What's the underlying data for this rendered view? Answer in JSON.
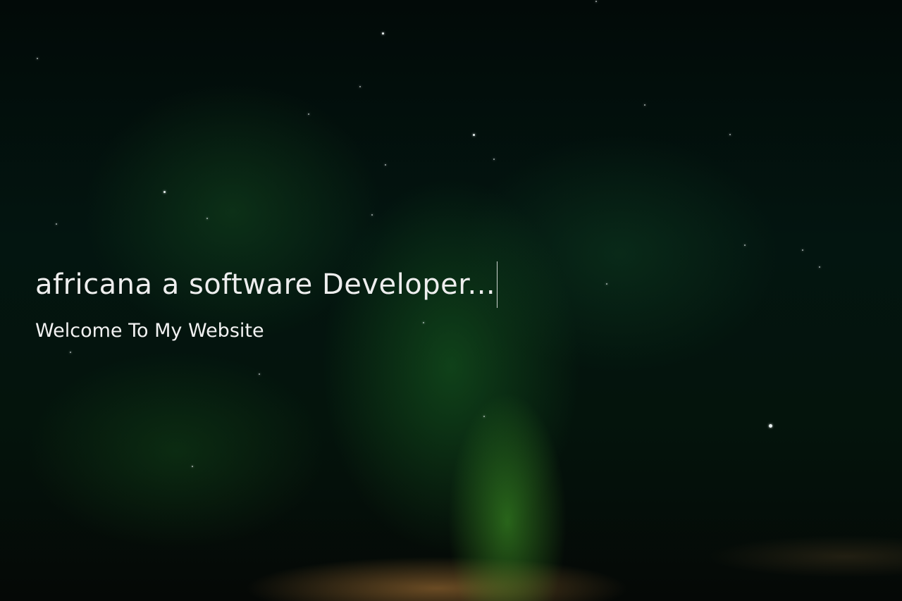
{
  "hero": {
    "headline": "africana a software Developer...",
    "subtitle": "Welcome To My Website"
  },
  "colors": {
    "background": "#020807",
    "aurora": "#2f8a2a",
    "text": "#eeeeee"
  }
}
